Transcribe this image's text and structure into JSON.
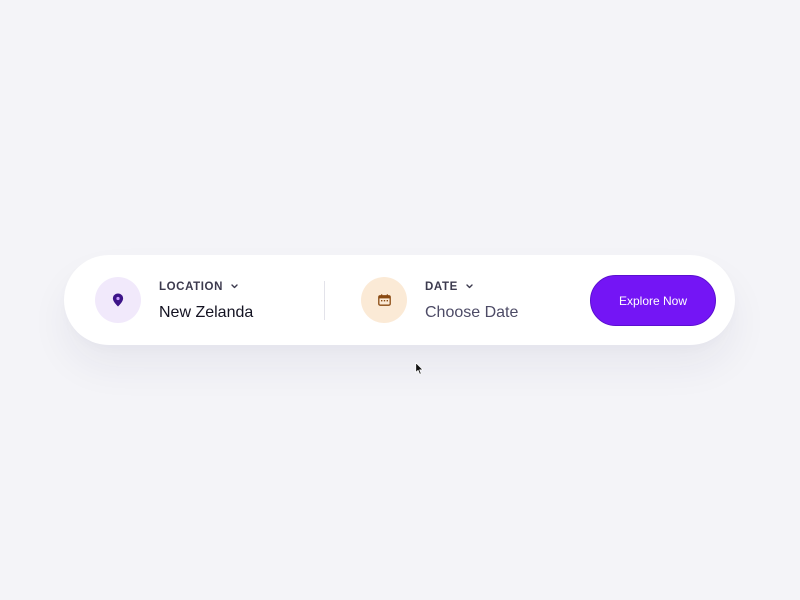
{
  "search": {
    "location": {
      "label": "LOCATION",
      "value": "New Zelanda",
      "icon": "location-pin-icon"
    },
    "date": {
      "label": "DATE",
      "value": "Choose Date",
      "icon": "calendar-icon"
    },
    "button_label": "Explore Now"
  },
  "colors": {
    "accent": "#7415f5",
    "background": "#f4f4f8",
    "location_icon_bg": "#f1e9fb",
    "date_icon_bg": "#fbead6"
  }
}
